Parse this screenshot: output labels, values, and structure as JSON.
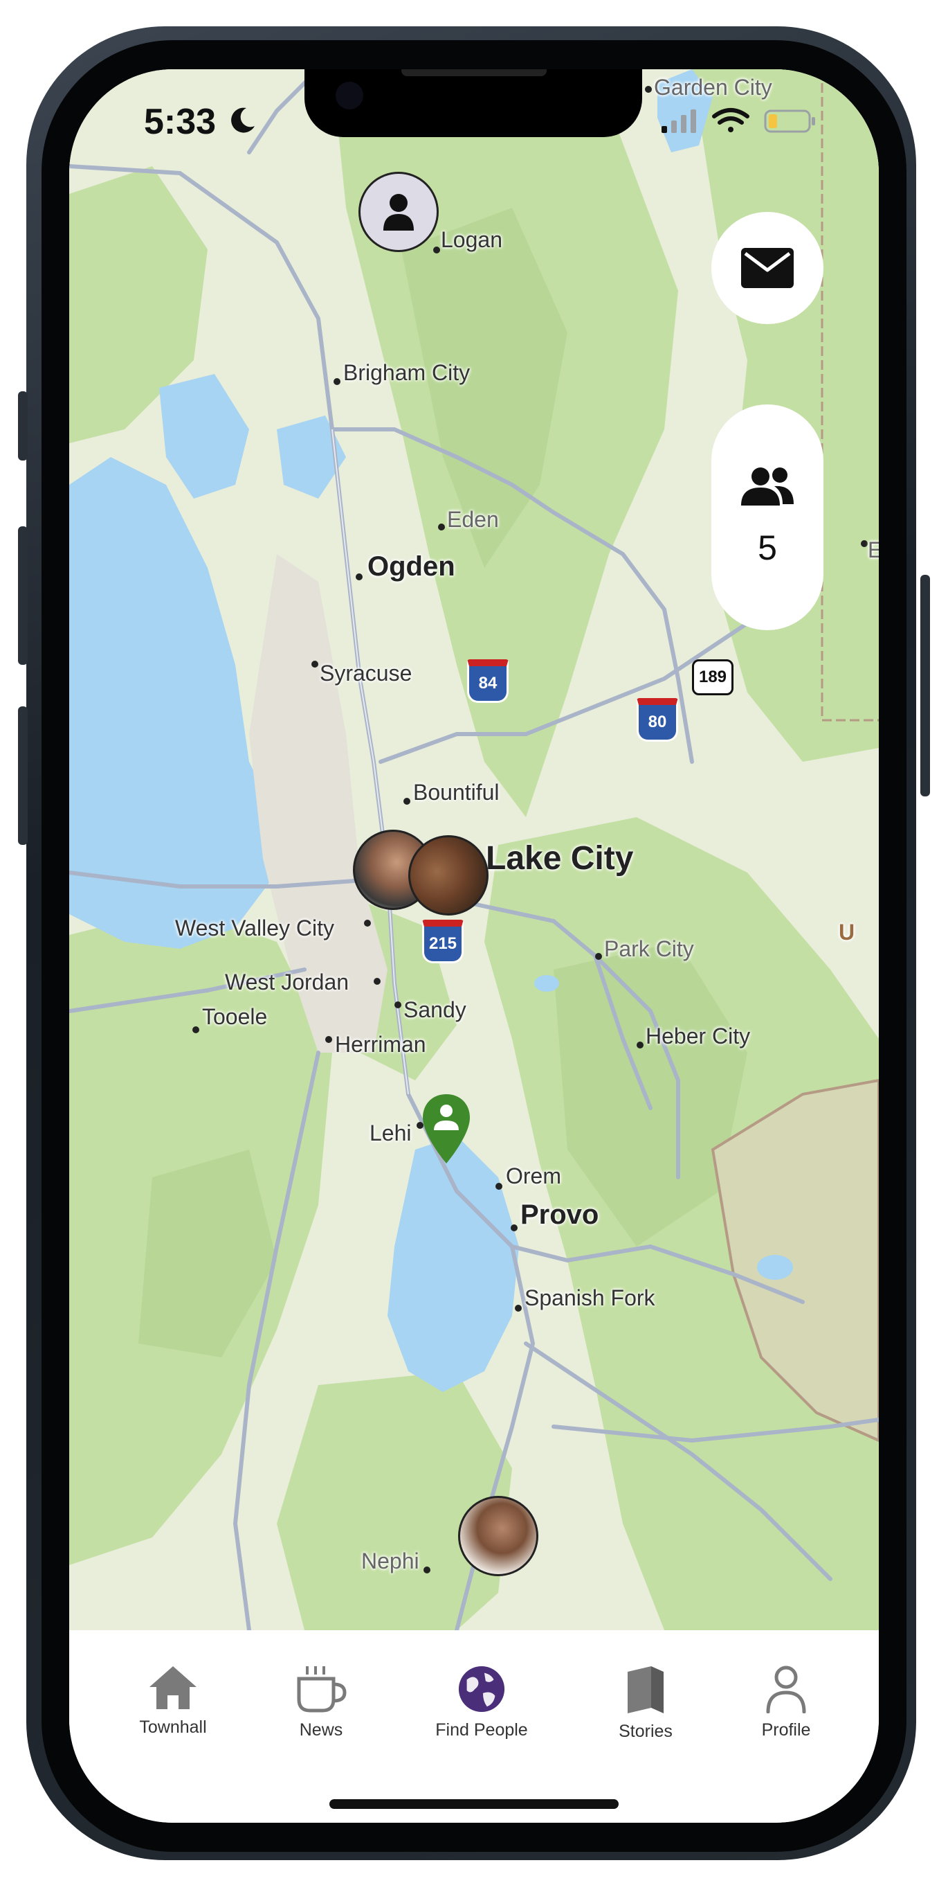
{
  "status_bar": {
    "time": "5:33",
    "icons": [
      "moon-icon",
      "cellular-icon",
      "wifi-icon",
      "battery-icon"
    ]
  },
  "map": {
    "towns": [
      {
        "name": "Garden City",
        "style": "dim"
      },
      {
        "name": "Logan",
        "style": "normal"
      },
      {
        "name": "Brigham City",
        "style": "normal"
      },
      {
        "name": "Eden",
        "style": "dim"
      },
      {
        "name": "Ogden",
        "style": "big"
      },
      {
        "name": "Syracuse",
        "style": "normal"
      },
      {
        "name": "Bountiful",
        "style": "normal"
      },
      {
        "name": "Lake City",
        "style": "huge"
      },
      {
        "name": "West Valley City",
        "style": "normal"
      },
      {
        "name": "West Jordan",
        "style": "normal"
      },
      {
        "name": "Sandy",
        "style": "normal"
      },
      {
        "name": "Tooele",
        "style": "normal"
      },
      {
        "name": "Herriman",
        "style": "normal"
      },
      {
        "name": "Park City",
        "style": "dim"
      },
      {
        "name": "Heber City",
        "style": "normal"
      },
      {
        "name": "Lehi",
        "style": "normal"
      },
      {
        "name": "Orem",
        "style": "normal"
      },
      {
        "name": "Provo",
        "style": "big"
      },
      {
        "name": "Spanish Fork",
        "style": "normal"
      },
      {
        "name": "Nephi",
        "style": "dim"
      },
      {
        "name": "E",
        "style": "dim"
      },
      {
        "name": "U",
        "style": "dim"
      }
    ],
    "shields": [
      {
        "label": "84",
        "kind": "interstate"
      },
      {
        "label": "215",
        "kind": "interstate"
      },
      {
        "label": "80",
        "kind": "interstate"
      },
      {
        "label": "189",
        "kind": "us"
      }
    ]
  },
  "controls": {
    "messages_icon": "envelope-icon",
    "friends_icon": "people-icon",
    "friends_count": "5"
  },
  "colors": {
    "land": "#e9eedb",
    "forest": "#c4dfa3",
    "water": "#a6d4f2",
    "road": "#a9b4c8",
    "pin": "#3f8a2a",
    "accent": "#4a2e7a"
  },
  "tabs": [
    {
      "label": "Townhall",
      "icon": "home-icon",
      "active": false
    },
    {
      "label": "News",
      "icon": "coffee-cup-icon",
      "active": false
    },
    {
      "label": "Find People",
      "icon": "globe-icon",
      "active": true
    },
    {
      "label": "Stories",
      "icon": "book-icon",
      "active": false
    },
    {
      "label": "Profile",
      "icon": "person-icon",
      "active": false
    }
  ]
}
